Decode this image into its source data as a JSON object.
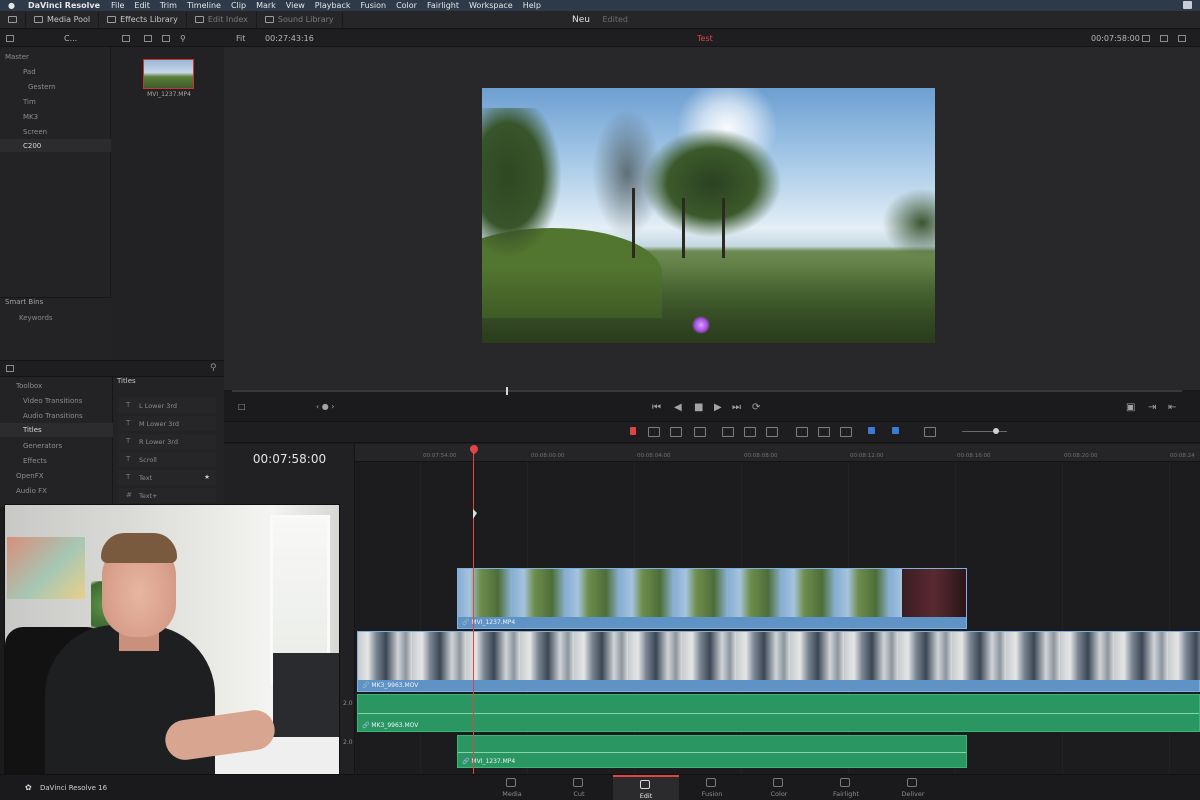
{
  "menubar": {
    "app_name": "DaVinci Resolve",
    "items": [
      "File",
      "Edit",
      "Trim",
      "Timeline",
      "Clip",
      "Mark",
      "View",
      "Playback",
      "Fusion",
      "Color",
      "Fairlight",
      "Workspace",
      "Help"
    ]
  },
  "toolbar": {
    "media_pool": "Media Pool",
    "effects_library": "Effects Library",
    "edit_index": "Edit Index",
    "sound_library": "Sound Library",
    "project_title": "Neu",
    "project_status": "Edited"
  },
  "subbar": {
    "bin_name": "C...",
    "zoom": "Fit",
    "source_timecode": "00:27:43:16",
    "timeline_name": "Test",
    "timeline_timecode": "00:07:58:00"
  },
  "bins": {
    "master": "Master",
    "items": [
      "Pad",
      "Gestern",
      "Tim",
      "MK3",
      "Screen",
      "C200"
    ],
    "selected": "C200",
    "smart_bins": "Smart Bins",
    "keywords": "Keywords"
  },
  "media": {
    "clip_name": "MVI_1237.MP4"
  },
  "effects": {
    "toolbox": "Toolbox",
    "categories": [
      "Video Transitions",
      "Audio Transitions",
      "Titles",
      "Generators",
      "Effects"
    ],
    "openfx": "OpenFX",
    "audio_fx": "Audio FX",
    "list_header": "Titles",
    "titles": [
      "L Lower 3rd",
      "M Lower 3rd",
      "R Lower 3rd",
      "Scroll",
      "Text",
      "Text+"
    ]
  },
  "timeline": {
    "timecode": "00:07:58:00",
    "ruler": [
      "00:07:54:00",
      "00:08:00:00",
      "00:08:04:00",
      "00:08:08:00",
      "00:08:12:00",
      "00:08:16:00",
      "00:08:20:00",
      "00:08:24"
    ],
    "clips": {
      "v2": "MVI_1237.MP4",
      "v1": "MK3_9963.MOV",
      "a1": "MK3_9963.MOV",
      "a2": "MVI_1237.MP4"
    },
    "track_a1": "2.0",
    "track_a2": "2.0"
  },
  "pages": [
    "Media",
    "Cut",
    "Edit",
    "Fusion",
    "Color",
    "Fairlight",
    "Deliver"
  ],
  "active_page": "Edit",
  "footer_app": "DaVinci Resolve 16"
}
